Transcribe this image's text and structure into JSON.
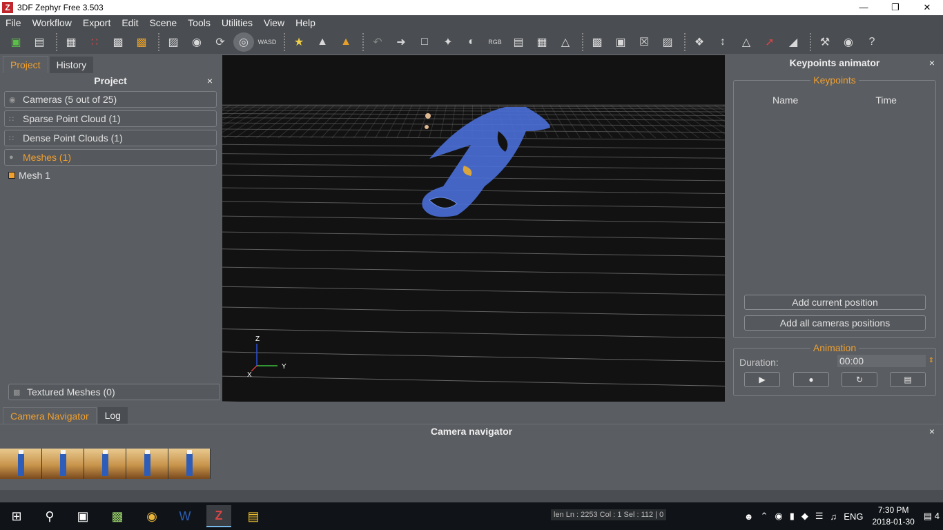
{
  "window": {
    "app_icon": "Z",
    "title": "3DF Zephyr Free 3.503",
    "min_icon": "minimize-icon",
    "max_icon": "maximize-icon",
    "close_icon": "close-icon"
  },
  "menu": [
    "File",
    "Workflow",
    "Export",
    "Edit",
    "Scene",
    "Tools",
    "Utilities",
    "View",
    "Help"
  ],
  "toolbar_icons": [
    "new-project-icon",
    "save-icon",
    "sparse-cloud-icon",
    "dense-cloud-icon",
    "mesh-icon",
    "textured-mesh-icon",
    "cube-icon",
    "camera-icon",
    "orbit-icon",
    "pivot-icon",
    "wasd-icon",
    "light-icon",
    "triangle-icon",
    "triangle-color-icon",
    "undo-icon",
    "redo-icon",
    "select-rect-icon",
    "select-point-icon",
    "invert-icon",
    "rgb-icon",
    "deselect-icon",
    "grid-select-icon",
    "lasso-icon",
    "select-all-icon",
    "crop-icon",
    "delete-icon",
    "box-icon",
    "link-icon",
    "vertical-axis-icon",
    "plane-icon",
    "axis-color-icon",
    "ruler-icon",
    "wrench-icon",
    "mask-icon",
    "help-icon"
  ],
  "left_panel": {
    "tabs": [
      "Project",
      "History"
    ],
    "active_tab": "Project",
    "title": "Project",
    "close": "×",
    "items": [
      {
        "label": "Cameras (5 out of 25)",
        "icon": "camera-icon"
      },
      {
        "label": "Sparse Point Cloud (1)",
        "icon": "sparse-cloud-icon"
      },
      {
        "label": "Dense Point Clouds (1)",
        "icon": "dense-cloud-icon"
      },
      {
        "label": "Meshes (1)",
        "icon": "mesh-icon"
      }
    ],
    "mesh_entry": "Mesh 1",
    "textured": "Textured Meshes (0)"
  },
  "viewport": {
    "axis_z": "Z",
    "axis_y": "Y",
    "axis_x": "X"
  },
  "right_panel": {
    "title": "Keypoints animator",
    "close": "×",
    "keypoints_legend": "Keypoints",
    "col_name": "Name",
    "col_time": "Time",
    "add_current": "Add current position",
    "add_all": "Add all cameras positions",
    "animation_legend": "Animation",
    "duration_label": "Duration:",
    "duration_value": "00:00",
    "anim_buttons": [
      "play-icon",
      "record-icon",
      "loop-icon",
      "stop-icon"
    ]
  },
  "bottom": {
    "tabs": [
      "Camera Navigator",
      "Log"
    ],
    "active_tab": "Camera Navigator",
    "title": "Camera navigator",
    "close": "×",
    "thumb_count": 5
  },
  "taskbar": {
    "status_text": "len Ln : 2253    Col : 1    Sel : 112 | 0",
    "lang": "ENG",
    "time": "7:30 PM",
    "date": "2018-01-30",
    "notifications": "4"
  },
  "colors": {
    "accent": "#f0a030",
    "panel": "#5a5d61",
    "viewport": "#121212",
    "mesh": "#4a6fd8"
  }
}
